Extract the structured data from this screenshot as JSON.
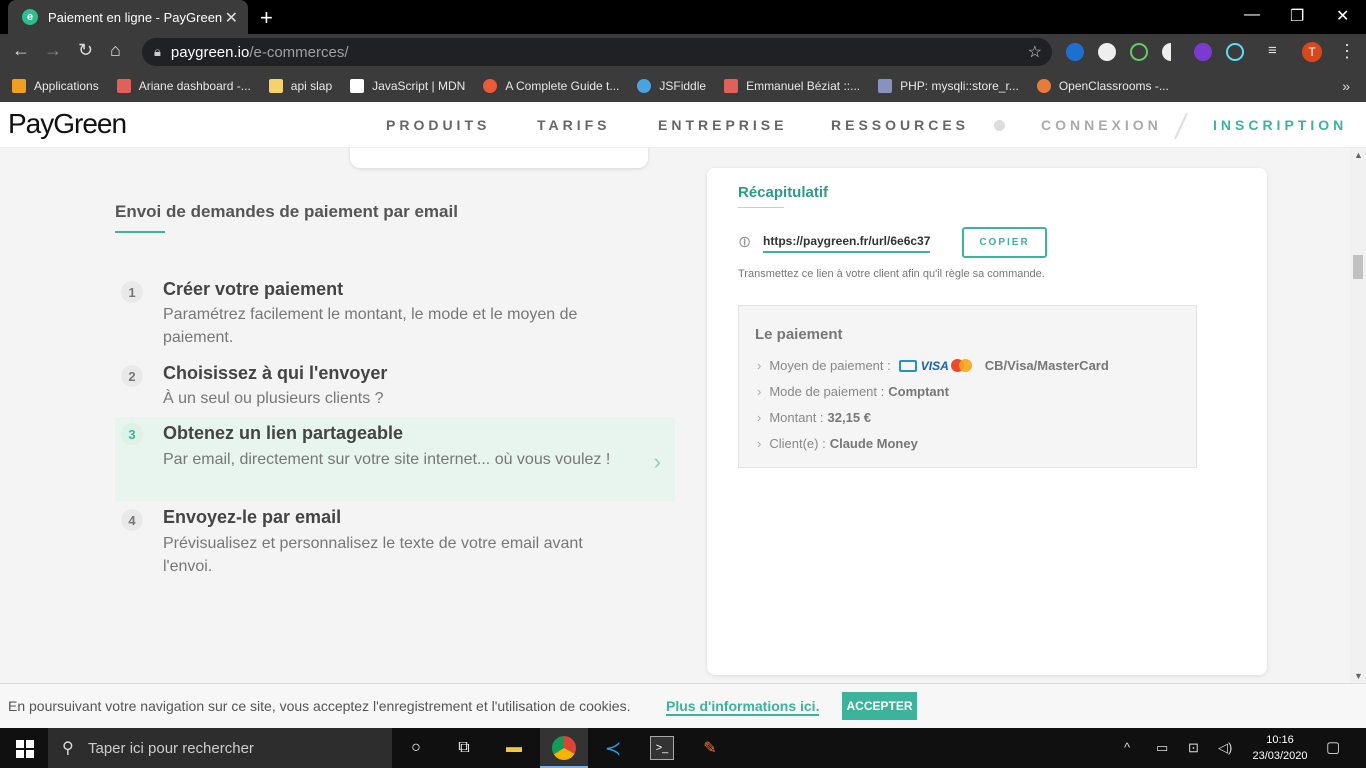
{
  "browser": {
    "tab_title": "Paiement en ligne - PayGreen",
    "tab_favicon": "e",
    "url_domain": "paygreen.io",
    "url_path": "/e-commerces/",
    "avatar_letter": "T",
    "bookmarks": [
      {
        "label": "Applications",
        "icon": "apps-grid-icon",
        "color": "#f0a020"
      },
      {
        "label": "Ariane dashboard -...",
        "icon": "rocket-icon",
        "color": "#e0605a"
      },
      {
        "label": "api slap",
        "icon": "folder-icon",
        "color": "#f5d26b"
      },
      {
        "label": "JavaScript | MDN",
        "icon": "mdn-icon",
        "color": "#ffffff"
      },
      {
        "label": "A Complete Guide t...",
        "icon": "css-tricks-icon",
        "color": "#e85c3a"
      },
      {
        "label": "JSFiddle",
        "icon": "cloud-icon",
        "color": "#4aa3df"
      },
      {
        "label": "Emmanuel Béziat ::...",
        "icon": "code-icon",
        "color": "#e0605a"
      },
      {
        "label": "PHP: mysqli::store_r...",
        "icon": "php-icon",
        "color": "#8892bf"
      },
      {
        "label": "OpenClassrooms -...",
        "icon": "gear-icon",
        "color": "#e87a3a"
      }
    ]
  },
  "site": {
    "logo": "PayGreen",
    "nav": {
      "produits": "PRODUITS",
      "tarifs": "TARIFS",
      "entreprise": "ENTREPRISE",
      "ressources": "RESSOURCES",
      "connexion": "CONNEXION",
      "inscription": "INSCRIPTION"
    },
    "accent_color": "#3cb49c"
  },
  "main": {
    "section_title": "Envoi de demandes de paiement par email",
    "steps": [
      {
        "num": "1",
        "title": "Créer votre paiement",
        "desc": "Paramétrez facilement le montant, le mode et le moyen de paiement."
      },
      {
        "num": "2",
        "title": "Choisissez à qui l'envoyer",
        "desc": "À un seul ou plusieurs clients ?"
      },
      {
        "num": "3",
        "title": "Obtenez un lien partageable",
        "desc": "Par email, directement sur votre site internet... où vous voulez !"
      },
      {
        "num": "4",
        "title": "Envoyez-le par email",
        "desc": "Prévisualisez et personnalisez le texte de votre email avant l'envoi."
      }
    ],
    "recap": {
      "title": "Récapitulatif",
      "url": "https://paygreen.fr/url/6e6c37",
      "copy_label": "COPIER",
      "hint": "Transmettez ce lien à votre client afin qu'il règle sa commande.",
      "payment_title": "Le paiement",
      "rows": {
        "moyen_label": "Moyen de paiement :",
        "moyen_visa": "VISA",
        "moyen_value": "CB/Visa/MasterCard",
        "mode_label": "Mode de paiement :",
        "mode_value": "Comptant",
        "montant_label": "Montant :",
        "montant_value": "32,15 €",
        "client_label": "Client(e) :",
        "client_value": "Claude Money"
      }
    }
  },
  "cookie": {
    "text": "En poursuivant votre navigation sur ce site, vous acceptez l'enregistrement et l'utilisation de cookies.",
    "link": "Plus d'informations ici.",
    "accept": "ACCEPTER"
  },
  "taskbar": {
    "search_placeholder": "Taper ici pour rechercher",
    "time": "10:16",
    "date": "23/03/2020"
  }
}
